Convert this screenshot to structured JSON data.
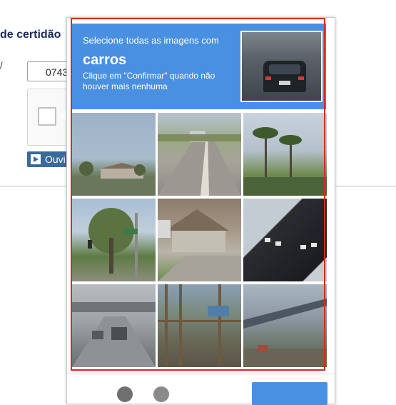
{
  "background": {
    "title": "de certidão",
    "field_mark": "/",
    "input_value": "0743",
    "audio_button_label": "Ouvi"
  },
  "captcha": {
    "instruction_line1": "Selecione todas as imagens com",
    "target_object": "carros",
    "instruction_line3": "Clique em \"Confirmar\" quando não houver mais nenhuma"
  },
  "tiles": [
    {
      "index": 1,
      "icon": "road-scene"
    },
    {
      "index": 2,
      "icon": "road-car-scene"
    },
    {
      "index": 3,
      "icon": "palm-trees-scene"
    },
    {
      "index": 4,
      "icon": "tree-street-sign-scene"
    },
    {
      "index": 5,
      "icon": "house-scene"
    },
    {
      "index": 6,
      "icon": "sign-closeup-scene"
    },
    {
      "index": 7,
      "icon": "highway-cars-scene"
    },
    {
      "index": 8,
      "icon": "fence-scene"
    },
    {
      "index": 9,
      "icon": "bridge-scene"
    }
  ],
  "colors": {
    "accent": "#4a90e2",
    "highlight_border": "#d42a2a",
    "page_text": "#1d2b5b"
  }
}
